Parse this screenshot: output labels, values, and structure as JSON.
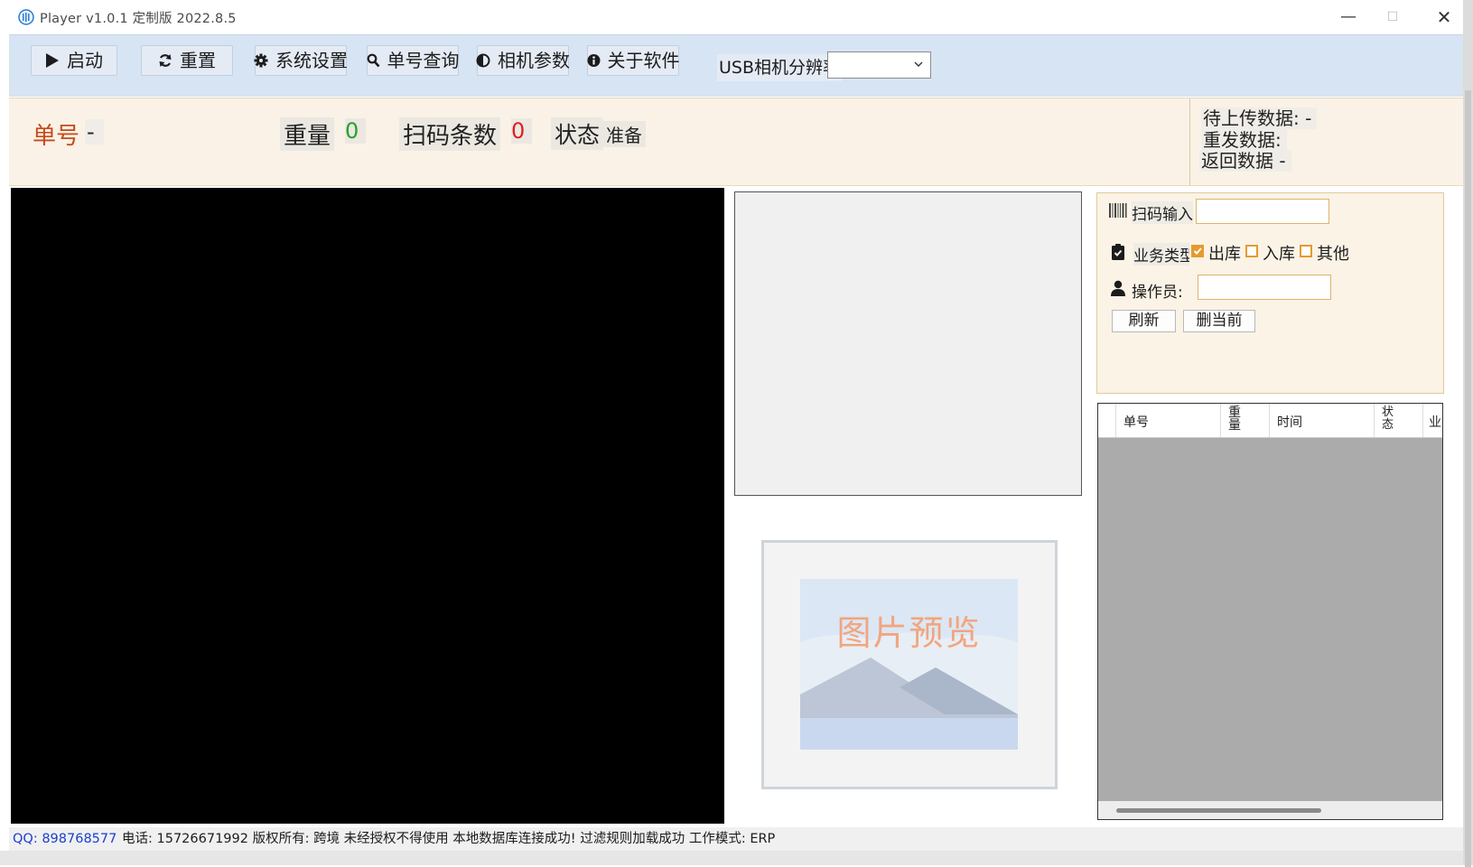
{
  "window": {
    "title": "Player v1.0.1  定制版 2022.8.5",
    "minimize": "—",
    "maximize": "☐",
    "close": "✕"
  },
  "toolbar": {
    "start_label": "启动",
    "reset_label": "重置",
    "settings_label": "系统设置",
    "query_label": "单号查询",
    "camera_params_label": "相机参数",
    "about_label": "关于软件",
    "usb_resolution_label": "USB相机分辨率",
    "usb_resolution_value": ""
  },
  "info": {
    "order_label": "单号",
    "order_value": "-",
    "weight_label": "重量",
    "weight_value": "0",
    "scan_count_label": "扫码条数",
    "scan_count_value": "0",
    "status_label": "状态",
    "status_value": "准备",
    "pending_upload_label": "待上传数据:",
    "pending_upload_value": "-",
    "resend_label": "重发数据:",
    "resend_value": "",
    "returned_label": "返回数据",
    "returned_value": "-"
  },
  "preview": {
    "placeholder_text": "图片预览"
  },
  "form": {
    "scan_input_label": "扫码输入",
    "scan_input_value": "",
    "business_type_label": "业务类型",
    "options": [
      {
        "label": "出库",
        "checked": true
      },
      {
        "label": "入库",
        "checked": false
      },
      {
        "label": "其他",
        "checked": false
      }
    ],
    "operator_label": "操作员:",
    "operator_value": "",
    "refresh_label": "刷新",
    "delete_current_label": "删当前"
  },
  "grid": {
    "columns": [
      "单号",
      "重量",
      "时间",
      "状态",
      "业"
    ],
    "rows": []
  },
  "statusbar": {
    "qq": "QQ: 898768577",
    "text": "电话: 15726671992 版权所有: 跨境 未经授权不得使用  本地数据库连接成功!   过滤规则加载成功 工作模式: ERP"
  },
  "colors": {
    "toolbar_bg": "#d7e4f3",
    "info_bg": "#faf2e6",
    "order_label": "#c64a1a",
    "weight_value": "#2aa02a",
    "scan_value": "#e02020",
    "checkbox_accent": "#e69a2e",
    "qq_link": "#1a3fd0"
  },
  "icons": {
    "start": "play-icon",
    "reset": "refresh-icon",
    "settings": "gear-icon",
    "query": "search-icon",
    "camera": "contrast-icon",
    "about": "info-icon",
    "scan": "barcode-icon",
    "business": "clipboard-check-icon",
    "operator": "user-icon"
  }
}
